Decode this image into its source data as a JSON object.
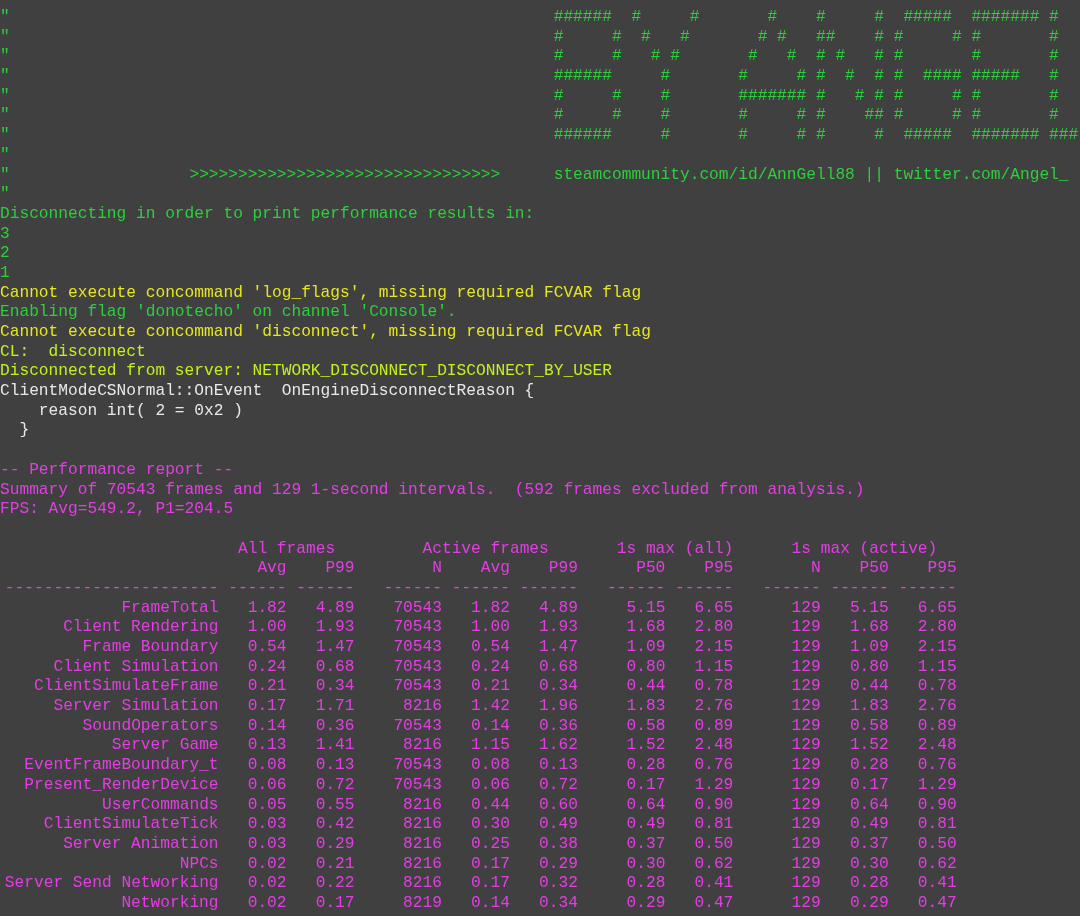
{
  "console": {
    "banner": [
      {
        "quote": "\"",
        "art": "######  #     #       #    #     #  #####  ####### #"
      },
      {
        "quote": "\"",
        "art": "#     #  #   #       # #   ##    # #     # #       #"
      },
      {
        "quote": "\"",
        "art": "#     #   # #       #   #  # #   # #       #       #"
      },
      {
        "quote": "\"",
        "art": "######     #       #     # #  #  # #  #### #####   #"
      },
      {
        "quote": "\"",
        "art": "#     #    #       ####### #   # # #     # #       #"
      },
      {
        "quote": "\"",
        "art": "#     #    #       #     # #    ## #     # #       #"
      },
      {
        "quote": "\"",
        "art": "######     #       #     # #     #  #####  ####### ###"
      },
      {
        "quote": "\""
      },
      {
        "quote": "\"",
        "arrows": ">>>>>>>>>>>>>>>>>>>>>>>>>>>>>>>>",
        "links": "steamcommunity.com/id/AnnGell88 || twitter.com/Angel_"
      },
      {
        "quote": "\""
      }
    ],
    "log": [
      {
        "kind": "info",
        "text": "Disconnecting in order to print performance results in:"
      },
      {
        "kind": "info",
        "text": "3"
      },
      {
        "kind": "info",
        "text": "2"
      },
      {
        "kind": "info",
        "text": "1"
      },
      {
        "kind": "warning",
        "text": "Cannot execute concommand 'log_flags', missing required FCVAR flag"
      },
      {
        "kind": "info",
        "text": "Enabling flag 'donotecho' on channel 'Console'."
      },
      {
        "kind": "warning",
        "text": "Cannot execute concommand 'disconnect', missing required FCVAR flag"
      },
      {
        "kind": "client",
        "text": "CL:  disconnect"
      },
      {
        "kind": "client",
        "text": "Disconnected from server: NETWORK_DISCONNECT_DISCONNECT_BY_USER"
      },
      {
        "kind": "plain",
        "text": "ClientModeCSNormal::OnEvent  OnEngineDisconnectReason {"
      },
      {
        "kind": "plain",
        "text": "    reason int( 2 = 0x2 )"
      },
      {
        "kind": "plain",
        "text": "  }"
      },
      {
        "kind": "blank"
      },
      {
        "kind": "perf",
        "text": "-- Performance report --"
      },
      {
        "kind": "perf",
        "text": "Summary of 70543 frames and 129 1-second intervals.  (592 frames excluded from analysis.)"
      },
      {
        "kind": "perf",
        "text": "FPS: Avg=549.2, P1=204.5"
      },
      {
        "kind": "blank"
      }
    ],
    "performance_table": {
      "group_headers": [
        "All frames",
        "Active frames",
        "1s max (all)",
        "1s max (active)"
      ],
      "columns": [
        "Avg",
        "P99",
        "N",
        "Avg",
        "P99",
        "P50",
        "P95",
        "N",
        "P50",
        "P95"
      ],
      "rule": [
        "----------------------",
        "------",
        "------",
        "------",
        "------",
        "------",
        "------",
        "------",
        "------",
        "------",
        "------"
      ],
      "rows": [
        {
          "name": "FrameTotal",
          "values": [
            "1.82",
            "4.89",
            "70543",
            "1.82",
            "4.89",
            "5.15",
            "6.65",
            "129",
            "5.15",
            "6.65"
          ]
        },
        {
          "name": "Client Rendering",
          "values": [
            "1.00",
            "1.93",
            "70543",
            "1.00",
            "1.93",
            "1.68",
            "2.80",
            "129",
            "1.68",
            "2.80"
          ]
        },
        {
          "name": "Frame Boundary",
          "values": [
            "0.54",
            "1.47",
            "70543",
            "0.54",
            "1.47",
            "1.09",
            "2.15",
            "129",
            "1.09",
            "2.15"
          ]
        },
        {
          "name": "Client Simulation",
          "values": [
            "0.24",
            "0.68",
            "70543",
            "0.24",
            "0.68",
            "0.80",
            "1.15",
            "129",
            "0.80",
            "1.15"
          ]
        },
        {
          "name": "ClientSimulateFrame",
          "values": [
            "0.21",
            "0.34",
            "70543",
            "0.21",
            "0.34",
            "0.44",
            "0.78",
            "129",
            "0.44",
            "0.78"
          ]
        },
        {
          "name": "Server Simulation",
          "values": [
            "0.17",
            "1.71",
            "8216",
            "1.42",
            "1.96",
            "1.83",
            "2.76",
            "129",
            "1.83",
            "2.76"
          ]
        },
        {
          "name": "SoundOperators",
          "values": [
            "0.14",
            "0.36",
            "70543",
            "0.14",
            "0.36",
            "0.58",
            "0.89",
            "129",
            "0.58",
            "0.89"
          ]
        },
        {
          "name": "Server Game",
          "values": [
            "0.13",
            "1.41",
            "8216",
            "1.15",
            "1.62",
            "1.52",
            "2.48",
            "129",
            "1.52",
            "2.48"
          ]
        },
        {
          "name": "EventFrameBoundary_t",
          "values": [
            "0.08",
            "0.13",
            "70543",
            "0.08",
            "0.13",
            "0.28",
            "0.76",
            "129",
            "0.28",
            "0.76"
          ]
        },
        {
          "name": "Present_RenderDevice",
          "values": [
            "0.06",
            "0.72",
            "70543",
            "0.06",
            "0.72",
            "0.17",
            "1.29",
            "129",
            "0.17",
            "1.29"
          ]
        },
        {
          "name": "UserCommands",
          "values": [
            "0.05",
            "0.55",
            "8216",
            "0.44",
            "0.60",
            "0.64",
            "0.90",
            "129",
            "0.64",
            "0.90"
          ]
        },
        {
          "name": "ClientSimulateTick",
          "values": [
            "0.03",
            "0.42",
            "8216",
            "0.30",
            "0.49",
            "0.49",
            "0.81",
            "129",
            "0.49",
            "0.81"
          ]
        },
        {
          "name": "Server Animation",
          "values": [
            "0.03",
            "0.29",
            "8216",
            "0.25",
            "0.38",
            "0.37",
            "0.50",
            "129",
            "0.37",
            "0.50"
          ]
        },
        {
          "name": "NPCs",
          "values": [
            "0.02",
            "0.21",
            "8216",
            "0.17",
            "0.29",
            "0.30",
            "0.62",
            "129",
            "0.30",
            "0.62"
          ]
        },
        {
          "name": "Server Send Networking",
          "values": [
            "0.02",
            "0.22",
            "8216",
            "0.17",
            "0.32",
            "0.28",
            "0.41",
            "129",
            "0.28",
            "0.41"
          ]
        },
        {
          "name": "Networking",
          "values": [
            "0.02",
            "0.17",
            "8219",
            "0.14",
            "0.34",
            "0.29",
            "0.47",
            "129",
            "0.29",
            "0.47"
          ]
        }
      ]
    }
  }
}
